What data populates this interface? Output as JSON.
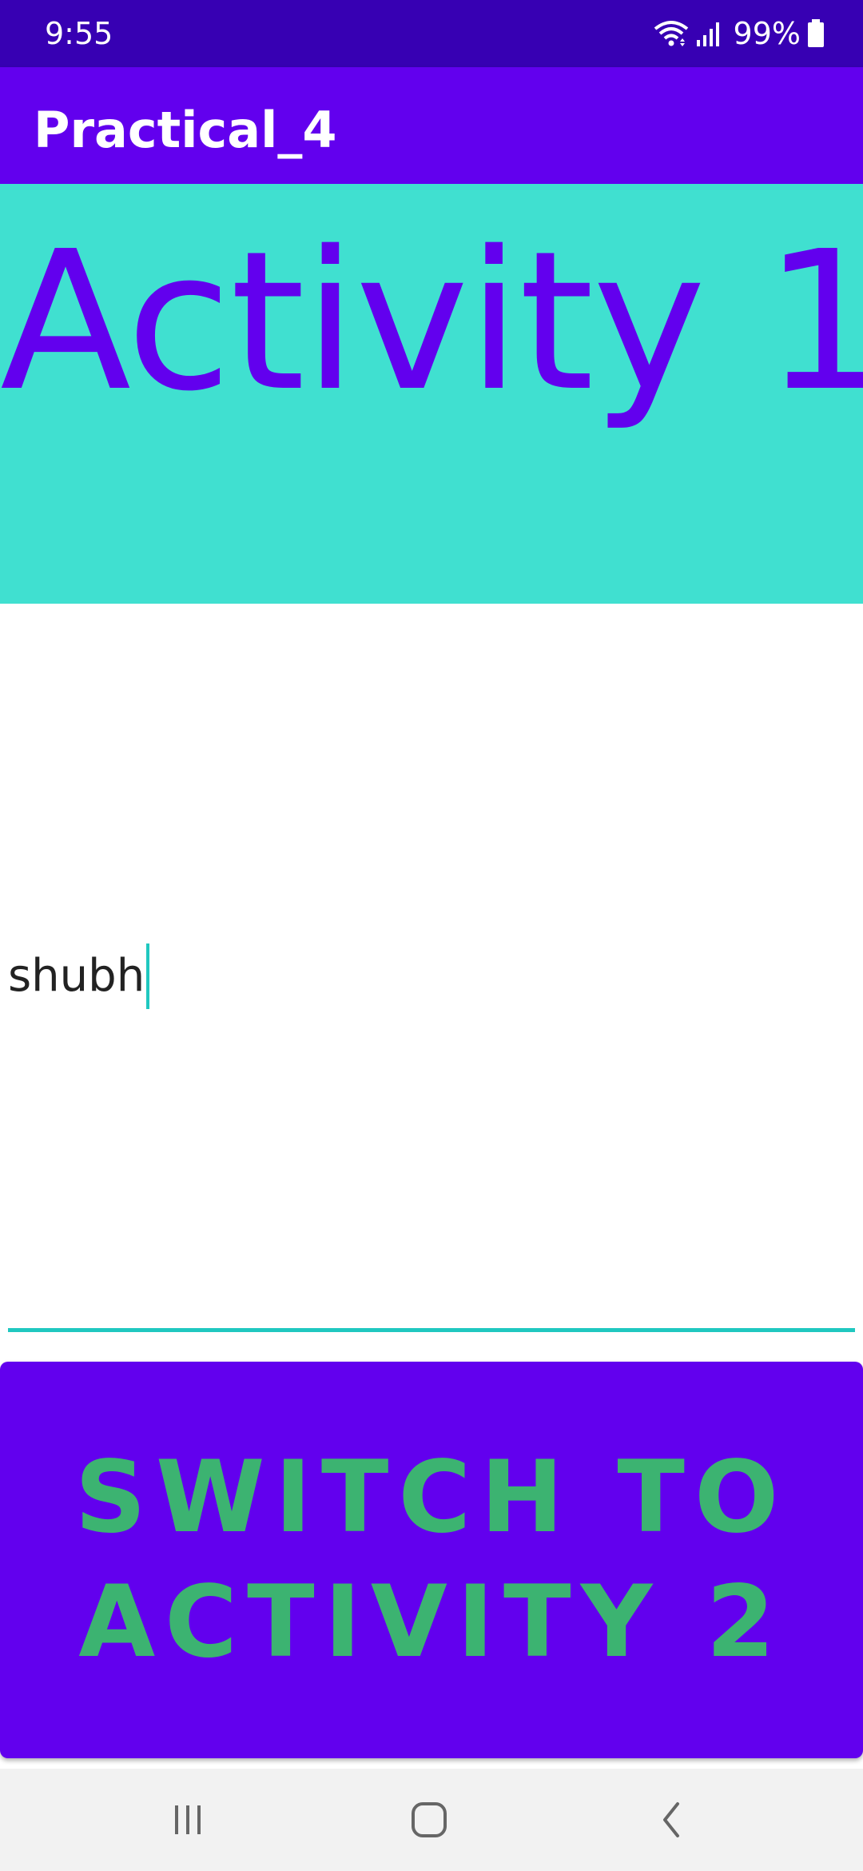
{
  "status_bar": {
    "time": "9:55",
    "battery": "99%",
    "icons": [
      "wifi-icon",
      "signal-icon",
      "battery-icon"
    ]
  },
  "app_bar": {
    "title": "Practical_4"
  },
  "hero": {
    "title": "Activity 1"
  },
  "input": {
    "value": "shubh",
    "placeholder": ""
  },
  "button": {
    "label": "SWITCH TO ACTIVITY 2"
  },
  "nav_bar": {
    "icons": [
      "recent-apps-icon",
      "home-icon",
      "back-icon"
    ]
  },
  "colors": {
    "status_bar": "#3700B3",
    "primary": "#6200EE",
    "hero_bg": "#40E0D0",
    "accent": "#20C8C0",
    "button_text": "#3CB371"
  }
}
